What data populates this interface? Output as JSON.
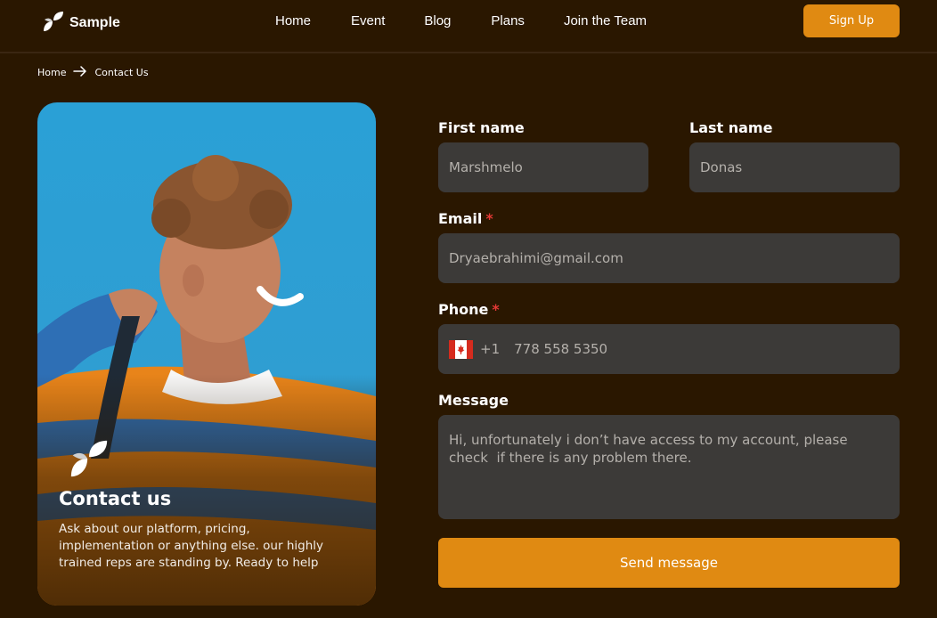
{
  "header": {
    "logo_text": "Sample",
    "nav": [
      "Home",
      "Event",
      "Blog",
      "Plans",
      "Join the Team"
    ],
    "signup_label": "Sign Up"
  },
  "breadcrumb": {
    "home": "Home",
    "current": "Contact Us"
  },
  "card": {
    "title": "Contact us",
    "description": "Ask about our platform, pricing, implementation or anything else. our highly trained reps are standing by. Ready to help"
  },
  "form": {
    "first_name": {
      "label": "First name",
      "value": "Marshmelo"
    },
    "last_name": {
      "label": "Last name",
      "value": "Donas"
    },
    "email": {
      "label": "Email",
      "required": "*",
      "value": "Dryaebrahimi@gmail.com"
    },
    "phone": {
      "label": "Phone",
      "required": "*",
      "country_code": "+1",
      "value": "778 558 5350"
    },
    "message": {
      "label": "Message",
      "value": "Hi, unfortunately i don’t have access to my account, please check  if there is any problem there."
    },
    "submit_label": "Send message"
  },
  "colors": {
    "background": "#2a1700",
    "accent": "#e08a12",
    "field_bg": "#3c3a38",
    "required": "#e53935"
  },
  "icons": {
    "logo": "leaf-logo-icon",
    "breadcrumb_separator": "arrow-right-icon",
    "flag": "canada-flag-icon"
  }
}
